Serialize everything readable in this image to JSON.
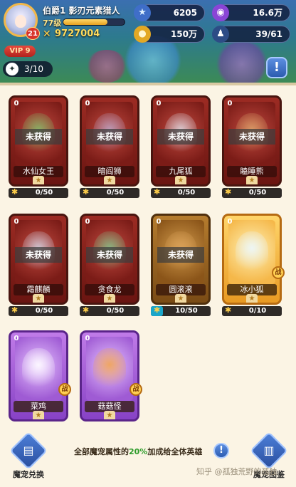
{
  "player": {
    "title": "伯爵1",
    "name": "影刃元素猎人",
    "level": "77级",
    "level_badge": "21",
    "exp_progress": 0.72,
    "power": "9727004",
    "vip": "VIP 9"
  },
  "resources": [
    {
      "icon": "star-icon",
      "value": "6205"
    },
    {
      "icon": "gem-icon",
      "value": "16.6万"
    },
    {
      "icon": "coin-icon",
      "value": "150万"
    },
    {
      "icon": "people-icon",
      "value": "39/61"
    }
  ],
  "team_count": "3/10",
  "pets": [
    {
      "name": "水仙女王",
      "stars": "0",
      "status": "未获得",
      "fragments": "0/50",
      "progress": 0,
      "rarity": "red"
    },
    {
      "name": "暗阎狮",
      "stars": "0",
      "status": "未获得",
      "fragments": "0/50",
      "progress": 0,
      "rarity": "red"
    },
    {
      "name": "九尾狐",
      "stars": "0",
      "status": "未获得",
      "fragments": "0/50",
      "progress": 0,
      "rarity": "red"
    },
    {
      "name": "瞌睡熊",
      "stars": "0",
      "status": "未获得",
      "fragments": "0/50",
      "progress": 0,
      "rarity": "red"
    },
    {
      "name": "霜麒麟",
      "stars": "0",
      "status": "未获得",
      "fragments": "0/50",
      "progress": 0,
      "rarity": "red"
    },
    {
      "name": "贪食龙",
      "stars": "0",
      "status": "未获得",
      "fragments": "0/50",
      "progress": 0,
      "rarity": "red"
    },
    {
      "name": "圆滚滚",
      "stars": "0",
      "status": "未获得",
      "fragments": "10/50",
      "progress": 0.2,
      "rarity": "brown"
    },
    {
      "name": "冰小狐",
      "stars": "0",
      "status": "",
      "fragments": "0/10",
      "progress": 0,
      "rarity": "gold",
      "battle": "战"
    },
    {
      "name": "菜鸡",
      "stars": "0",
      "status": "",
      "fragments": "",
      "progress": 0,
      "rarity": "purple",
      "battle": "战"
    },
    {
      "name": "菇菇怪",
      "stars": "0",
      "status": "",
      "fragments": "",
      "progress": 0,
      "rarity": "purple",
      "battle": "战"
    }
  ],
  "bottom": {
    "exchange_label": "魔宠兑换",
    "atlas_label": "魔宠图鉴",
    "bonus_prefix": "全部魔宠属性的",
    "bonus_pct": "20%",
    "bonus_suffix": "加成给全体英雄",
    "watermark": "知乎 @孤独荒野的孤独"
  },
  "colors": {
    "panel_bg": "#fbf4e4",
    "red_card": "#9c2b23",
    "gold_card": "#ffd56a",
    "purple_card": "#c07be8",
    "bonus_green": "#2b9a28"
  }
}
